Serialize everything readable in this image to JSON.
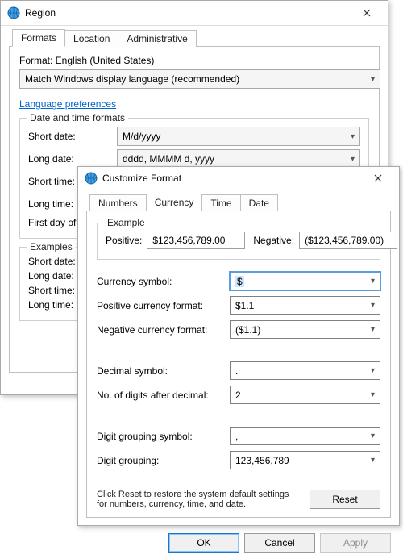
{
  "region": {
    "title": "Region",
    "tabs": [
      "Formats",
      "Location",
      "Administrative"
    ],
    "active_tab": 0,
    "format_label": "Format: English (United States)",
    "format_value": "Match Windows display language (recommended)",
    "lang_pref": "Language preferences",
    "dt_group": "Date and time formats",
    "rows": {
      "short_date": {
        "label": "Short date:",
        "value": "M/d/yyyy"
      },
      "long_date": {
        "label": "Long date:",
        "value": "dddd, MMMM d, yyyy"
      },
      "short_time": {
        "label": "Short time:",
        "value": ""
      },
      "long_time": {
        "label": "Long time:",
        "value": ""
      },
      "first_dow": {
        "label": "First day of wee",
        "value": ""
      }
    },
    "examples_group": "Examples",
    "examples": {
      "short_date": "Short date:",
      "long_date": "Long date:",
      "short_time": "Short time:",
      "long_time": "Long time:"
    }
  },
  "customize": {
    "title": "Customize Format",
    "tabs": [
      "Numbers",
      "Currency",
      "Time",
      "Date"
    ],
    "active_tab": 1,
    "example_group": "Example",
    "positive_label": "Positive:",
    "positive_value": "$123,456,789.00",
    "negative_label": "Negative:",
    "negative_value": "($123,456,789.00)",
    "fields": {
      "currency_symbol": {
        "label": "Currency symbol:",
        "value": "$"
      },
      "pos_fmt": {
        "label": "Positive currency format:",
        "value": "$1.1"
      },
      "neg_fmt": {
        "label": "Negative currency format:",
        "value": "($1.1)"
      },
      "dec_sym": {
        "label": "Decimal symbol:",
        "value": "."
      },
      "dec_digits": {
        "label": "No. of digits after decimal:",
        "value": "2"
      },
      "group_sym": {
        "label": "Digit grouping symbol:",
        "value": ","
      },
      "grouping": {
        "label": "Digit grouping:",
        "value": "123,456,789"
      }
    },
    "reset_text": "Click Reset to restore the system default settings for numbers, currency, time, and date.",
    "reset_btn": "Reset",
    "ok": "OK",
    "cancel": "Cancel",
    "apply": "Apply"
  }
}
